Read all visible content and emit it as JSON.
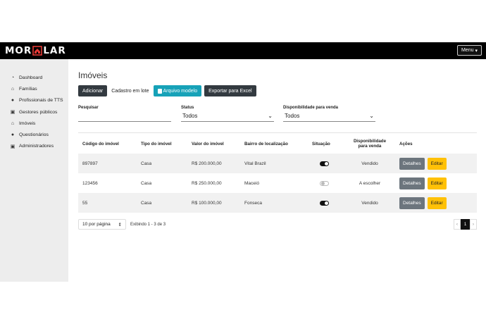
{
  "navbar": {
    "logo_left": "MOR",
    "logo_right": "LAR",
    "menu_label": "Menu"
  },
  "sidebar": {
    "items": [
      {
        "label": "Dashboard",
        "icon": "dashboard-icon"
      },
      {
        "label": "Famílias",
        "icon": "home-icon"
      },
      {
        "label": "Profissionais de TTS",
        "icon": "user-icon"
      },
      {
        "label": "Gestores públicos",
        "icon": "id-card-icon"
      },
      {
        "label": "Imóveis",
        "icon": "house-icon"
      },
      {
        "label": "Questionários",
        "icon": "question-icon"
      },
      {
        "label": "Administradores",
        "icon": "id-card-icon"
      }
    ]
  },
  "main": {
    "title": "Imóveis",
    "actions": {
      "add": "Adicionar",
      "batch": "Cadastro em lote",
      "template": "Arquivo modelo",
      "export": "Exportar para Excel"
    },
    "filters": {
      "search_label": "Pesquisar",
      "search_value": "",
      "status_label": "Status",
      "status_value": "Todos",
      "availability_label": "Disponibilidade para venda",
      "availability_value": "Todos"
    },
    "table": {
      "headers": {
        "code": "Código do imóvel",
        "type": "Tipo do imóvel",
        "value": "Valor do imóvel",
        "neighborhood": "Bairro de localização",
        "status": "Situação",
        "availability_line1": "Disponibilidade",
        "availability_line2": "para venda",
        "actions": "Ações"
      },
      "rows": [
        {
          "code": "897897",
          "type": "Casa",
          "value": "R$ 200.000,00",
          "neighborhood": "Vital Brazil",
          "active": true,
          "availability": "Vendido",
          "details": "Detalhes",
          "edit": "Editar"
        },
        {
          "code": "123456",
          "type": "Casa",
          "value": "R$ 250.000,00",
          "neighborhood": "Maceió",
          "active": false,
          "availability": "A escolher",
          "details": "Detalhes",
          "edit": "Editar"
        },
        {
          "code": "55",
          "type": "Casa",
          "value": "R$ 100.000,00",
          "neighborhood": "Fonseca",
          "active": true,
          "availability": "Vendido",
          "details": "Detalhes",
          "edit": "Editar"
        }
      ]
    },
    "pagination": {
      "per_page": "10 por página",
      "showing": "Exibindo 1 - 3 de 3",
      "prev": "‹",
      "current": "1",
      "next": "›"
    }
  },
  "colors": {
    "navbar": "#000000",
    "sidebar": "#ededed",
    "accent_info": "#17a2b8",
    "warning": "#ffc107",
    "secondary": "#6c757d",
    "logo_house": "#e53935"
  }
}
